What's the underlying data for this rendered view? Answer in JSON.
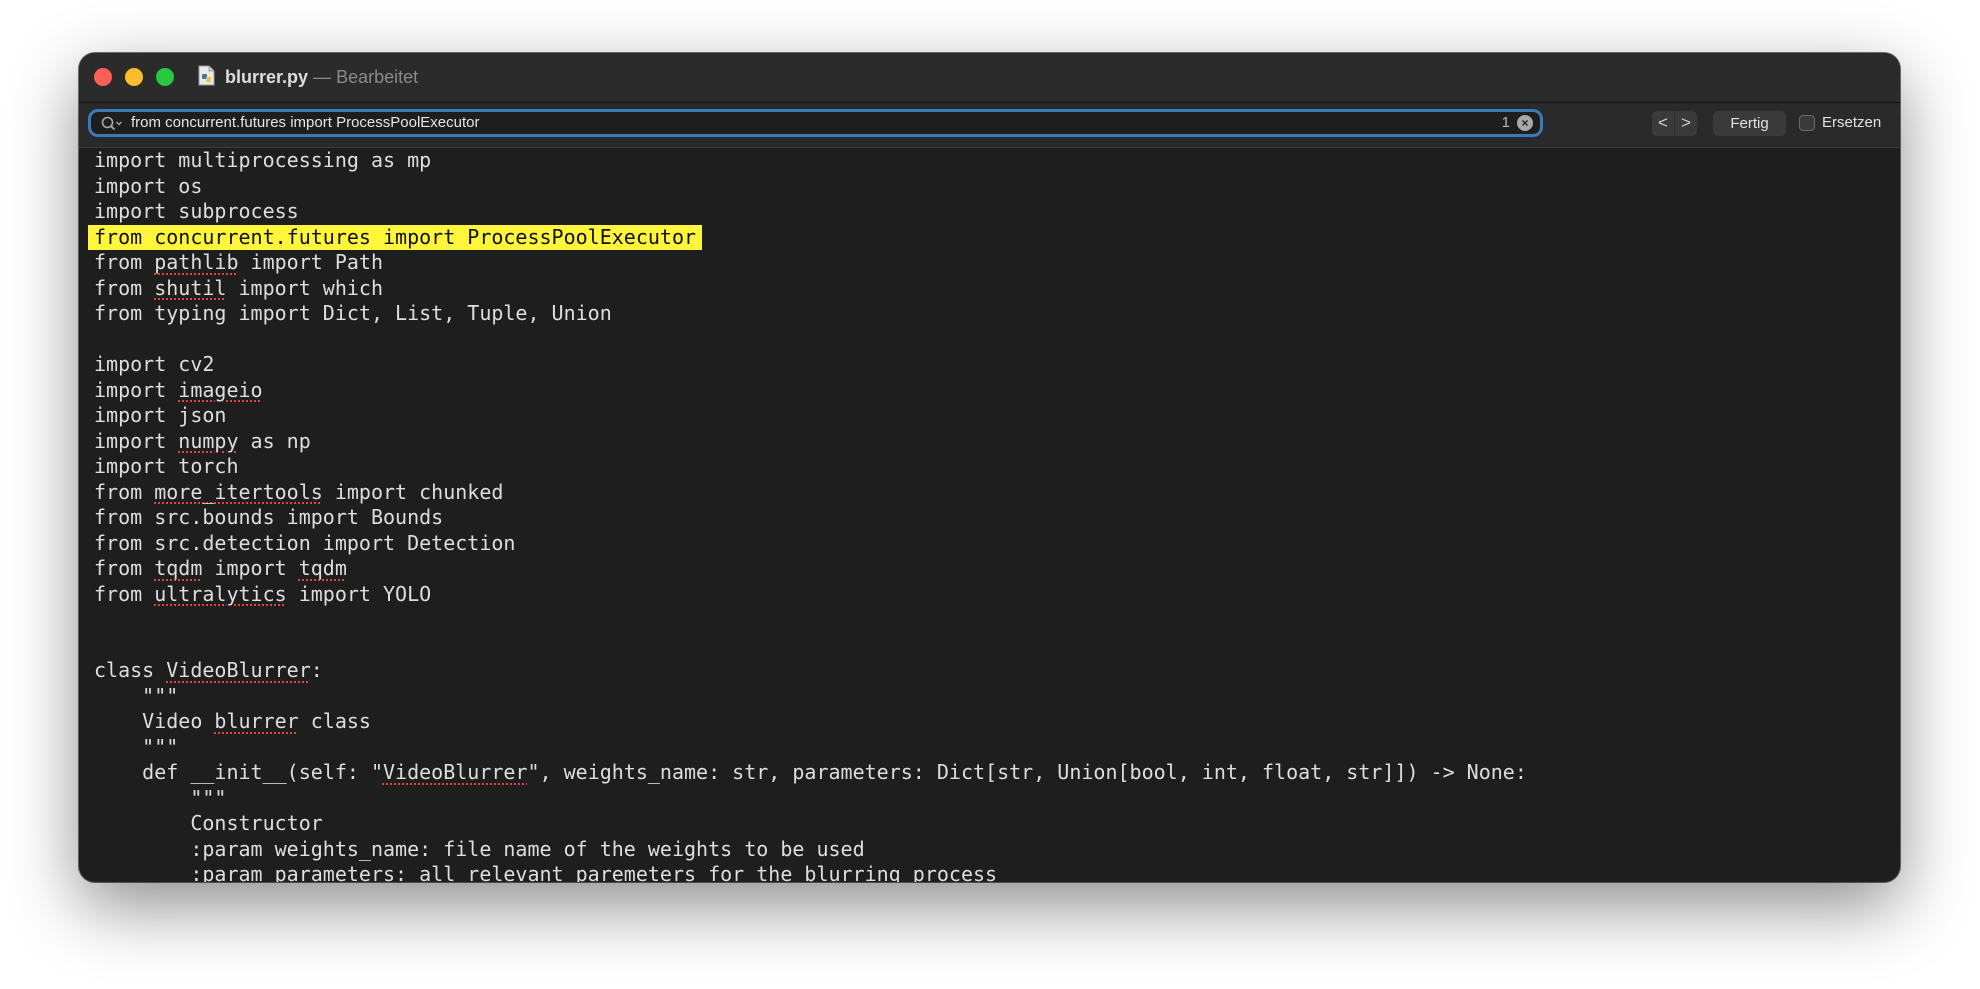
{
  "window": {
    "file_name": "blurrer.py",
    "separator": "—",
    "status": "Bearbeitet"
  },
  "find_bar": {
    "query": "from concurrent.futures import ProcessPoolExecutor",
    "match_count": "1",
    "prev_label": "<",
    "next_label": ">",
    "done_label": "Fertig",
    "replace_label": "Ersetzen",
    "replace_checked": false
  },
  "colors": {
    "search_border": "#3d79b8",
    "highlight": "#fff53b",
    "editor_bg": "#1e1e1e",
    "text": "#dedede"
  },
  "code": {
    "highlighted_line": 3,
    "lines": [
      "import multiprocessing as mp",
      "import os",
      "import subprocess",
      "from concurrent.futures import ProcessPoolExecutor",
      "from pathlib import Path",
      "from shutil import which",
      "from typing import Dict, List, Tuple, Union",
      "",
      "import cv2",
      "import imageio",
      "import json",
      "import numpy as np",
      "import torch",
      "from more_itertools import chunked",
      "from src.bounds import Bounds",
      "from src.detection import Detection",
      "from tqdm import tqdm",
      "from ultralytics import YOLO",
      "",
      "",
      "class VideoBlurrer:",
      "    \"\"\"",
      "    Video blurrer class",
      "    \"\"\"",
      "    def __init__(self: \"VideoBlurrer\", weights_name: str, parameters: Dict[str, Union[bool, int, float, str]]) -> None:",
      "        \"\"\"",
      "        Constructor",
      "        :param weights_name: file name of the weights to be used",
      "        :param parameters: all relevant paremeters for the blurring process"
    ]
  }
}
